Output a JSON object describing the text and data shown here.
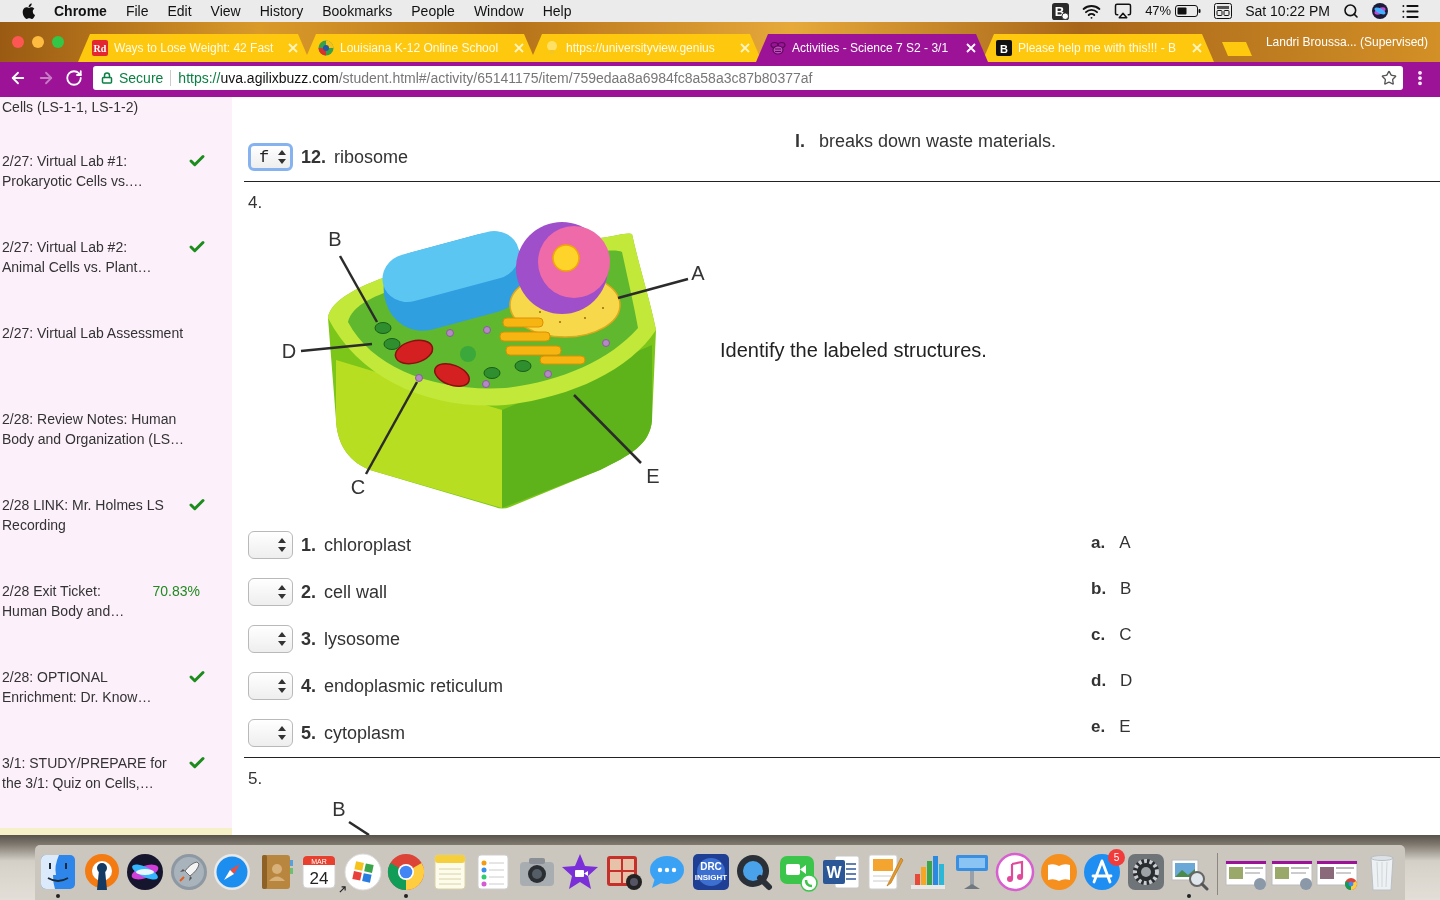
{
  "menu_bar": {
    "app": "Chrome",
    "menus": [
      "File",
      "Edit",
      "View",
      "History",
      "Bookmarks",
      "People",
      "Window",
      "Help"
    ],
    "status_items": [
      {
        "kind": "app",
        "letter": "B"
      },
      {
        "kind": "wifi"
      },
      {
        "kind": "airplay"
      },
      {
        "kind": "battery",
        "text": "47%"
      },
      {
        "kind": "keyboard"
      },
      {
        "kind": "clock",
        "text": "Sat 10:22 PM"
      },
      {
        "kind": "search"
      },
      {
        "kind": "siri"
      },
      {
        "kind": "list"
      }
    ]
  },
  "tabs": [
    {
      "kind": "rd",
      "favicon_text": "Rd",
      "title": "Ways to Lose Weight: 42 Fast",
      "selected": false
    },
    {
      "kind": "ball",
      "title": "Louisiana K-12 Online School",
      "selected": false
    },
    {
      "kind": "bulb",
      "title": "https://universityview.genius",
      "selected": false
    },
    {
      "kind": "bee",
      "title": "Activities - Science 7 S2 - 3/1",
      "selected": true
    },
    {
      "kind": "letter",
      "favicon_text": "B",
      "title": "Please help me with this!!! - B",
      "selected": false
    }
  ],
  "profile": "Landri Broussa... (Supervised)",
  "address_bar": {
    "security": "Secure",
    "url_scheme": "https://",
    "url_host": "uva.agilixbuzz.com",
    "url_path": "/student.html#/activity/65141175/item/759edaa8a6984fc8a58a3c87b80377af"
  },
  "sidebar": {
    "heading": "Cells (LS-1-1, LS-1-2)",
    "items": [
      {
        "title": "2/27: Virtual Lab #1: Prokaryotic Cells vs.…",
        "completed": true
      },
      {
        "title": "2/27: Virtual Lab #2: Animal Cells vs. Plant…",
        "completed": true
      },
      {
        "title": "2/27: Virtual Lab Assessment",
        "completed": false
      },
      {
        "title": "2/28: Review Notes: Human Body and Organization (LS…",
        "completed": false
      },
      {
        "title": "2/28 LINK: Mr. Holmes LS Recording",
        "completed": true
      },
      {
        "title": "2/28 Exit Ticket: Human Body and…",
        "completed": false,
        "score": "70.83%"
      },
      {
        "title": "2/28: OPTIONAL Enrichment: Dr. Know…",
        "completed": true
      },
      {
        "title": "3/1: STUDY/PREPARE for the 3/1: Quiz on Cells,…",
        "completed": true
      }
    ]
  },
  "questions": [
    {
      "kind": "matching_end",
      "items": [
        {
          "number": "12.",
          "term": "ribosome",
          "answer": "f",
          "focused": true
        }
      ],
      "options": [
        {
          "letter": "l.",
          "text": "breaks down waste materials."
        }
      ]
    },
    {
      "kind": "diagram_matching",
      "number": "4.",
      "figure": {
        "labels": [
          "B",
          "A",
          "D",
          "C",
          "E"
        ]
      },
      "prompt": "Identify the labeled structures.",
      "items": [
        {
          "number": "1.",
          "term": "chloroplast",
          "focused": false
        },
        {
          "number": "2.",
          "term": "cell wall",
          "focused": false
        },
        {
          "number": "3.",
          "term": "lysosome",
          "focused": false
        },
        {
          "number": "4.",
          "term": "endoplasmic reticulum",
          "focused": false
        },
        {
          "number": "5.",
          "term": "cytoplasm",
          "focused": false
        }
      ],
      "options": [
        {
          "letter": "a.",
          "text": "A"
        },
        {
          "letter": "b.",
          "text": "B"
        },
        {
          "letter": "c.",
          "text": "C"
        },
        {
          "letter": "d.",
          "text": "D"
        },
        {
          "letter": "e.",
          "text": "E"
        }
      ]
    },
    {
      "kind": "diagram_partial",
      "number": "5.",
      "figure": {
        "labels": [
          "B"
        ]
      }
    }
  ],
  "dock": {
    "apps": [
      {
        "kind": "finder",
        "running": true
      },
      {
        "kind": "keyhole",
        "running": false
      },
      {
        "kind": "siri",
        "running": false
      },
      {
        "kind": "launchpad",
        "running": false
      },
      {
        "kind": "safari",
        "running": false
      },
      {
        "kind": "contacts",
        "running": false
      },
      {
        "kind": "calendar",
        "month": "MAR",
        "day": "24",
        "running": false
      },
      {
        "kind": "tiles",
        "running": false
      },
      {
        "kind": "chrome",
        "running": true
      },
      {
        "kind": "notes",
        "running": false
      },
      {
        "kind": "reminders",
        "running": false
      },
      {
        "kind": "camera",
        "running": false
      },
      {
        "kind": "imovie",
        "running": false
      },
      {
        "kind": "photobooth",
        "running": false
      },
      {
        "kind": "messages",
        "running": false
      },
      {
        "kind": "drc",
        "lines": [
          "DRC",
          "INSIGHT"
        ],
        "running": false
      },
      {
        "kind": "quicktime",
        "running": false
      },
      {
        "kind": "facetime",
        "running": false
      },
      {
        "kind": "word",
        "letter": "W",
        "running": false
      },
      {
        "kind": "pages",
        "running": false
      },
      {
        "kind": "numbers",
        "running": false
      },
      {
        "kind": "keynote",
        "running": false
      },
      {
        "kind": "itunes",
        "running": false
      },
      {
        "kind": "ibooks",
        "running": false
      },
      {
        "kind": "appstore",
        "badge": "5",
        "running": false
      },
      {
        "kind": "sysprefs",
        "running": false
      },
      {
        "kind": "preview",
        "running": true
      }
    ],
    "others": [
      {
        "kind": "window_thumb"
      },
      {
        "kind": "window_thumb"
      },
      {
        "kind": "window_thumb_chrome"
      },
      {
        "kind": "trash"
      }
    ]
  }
}
